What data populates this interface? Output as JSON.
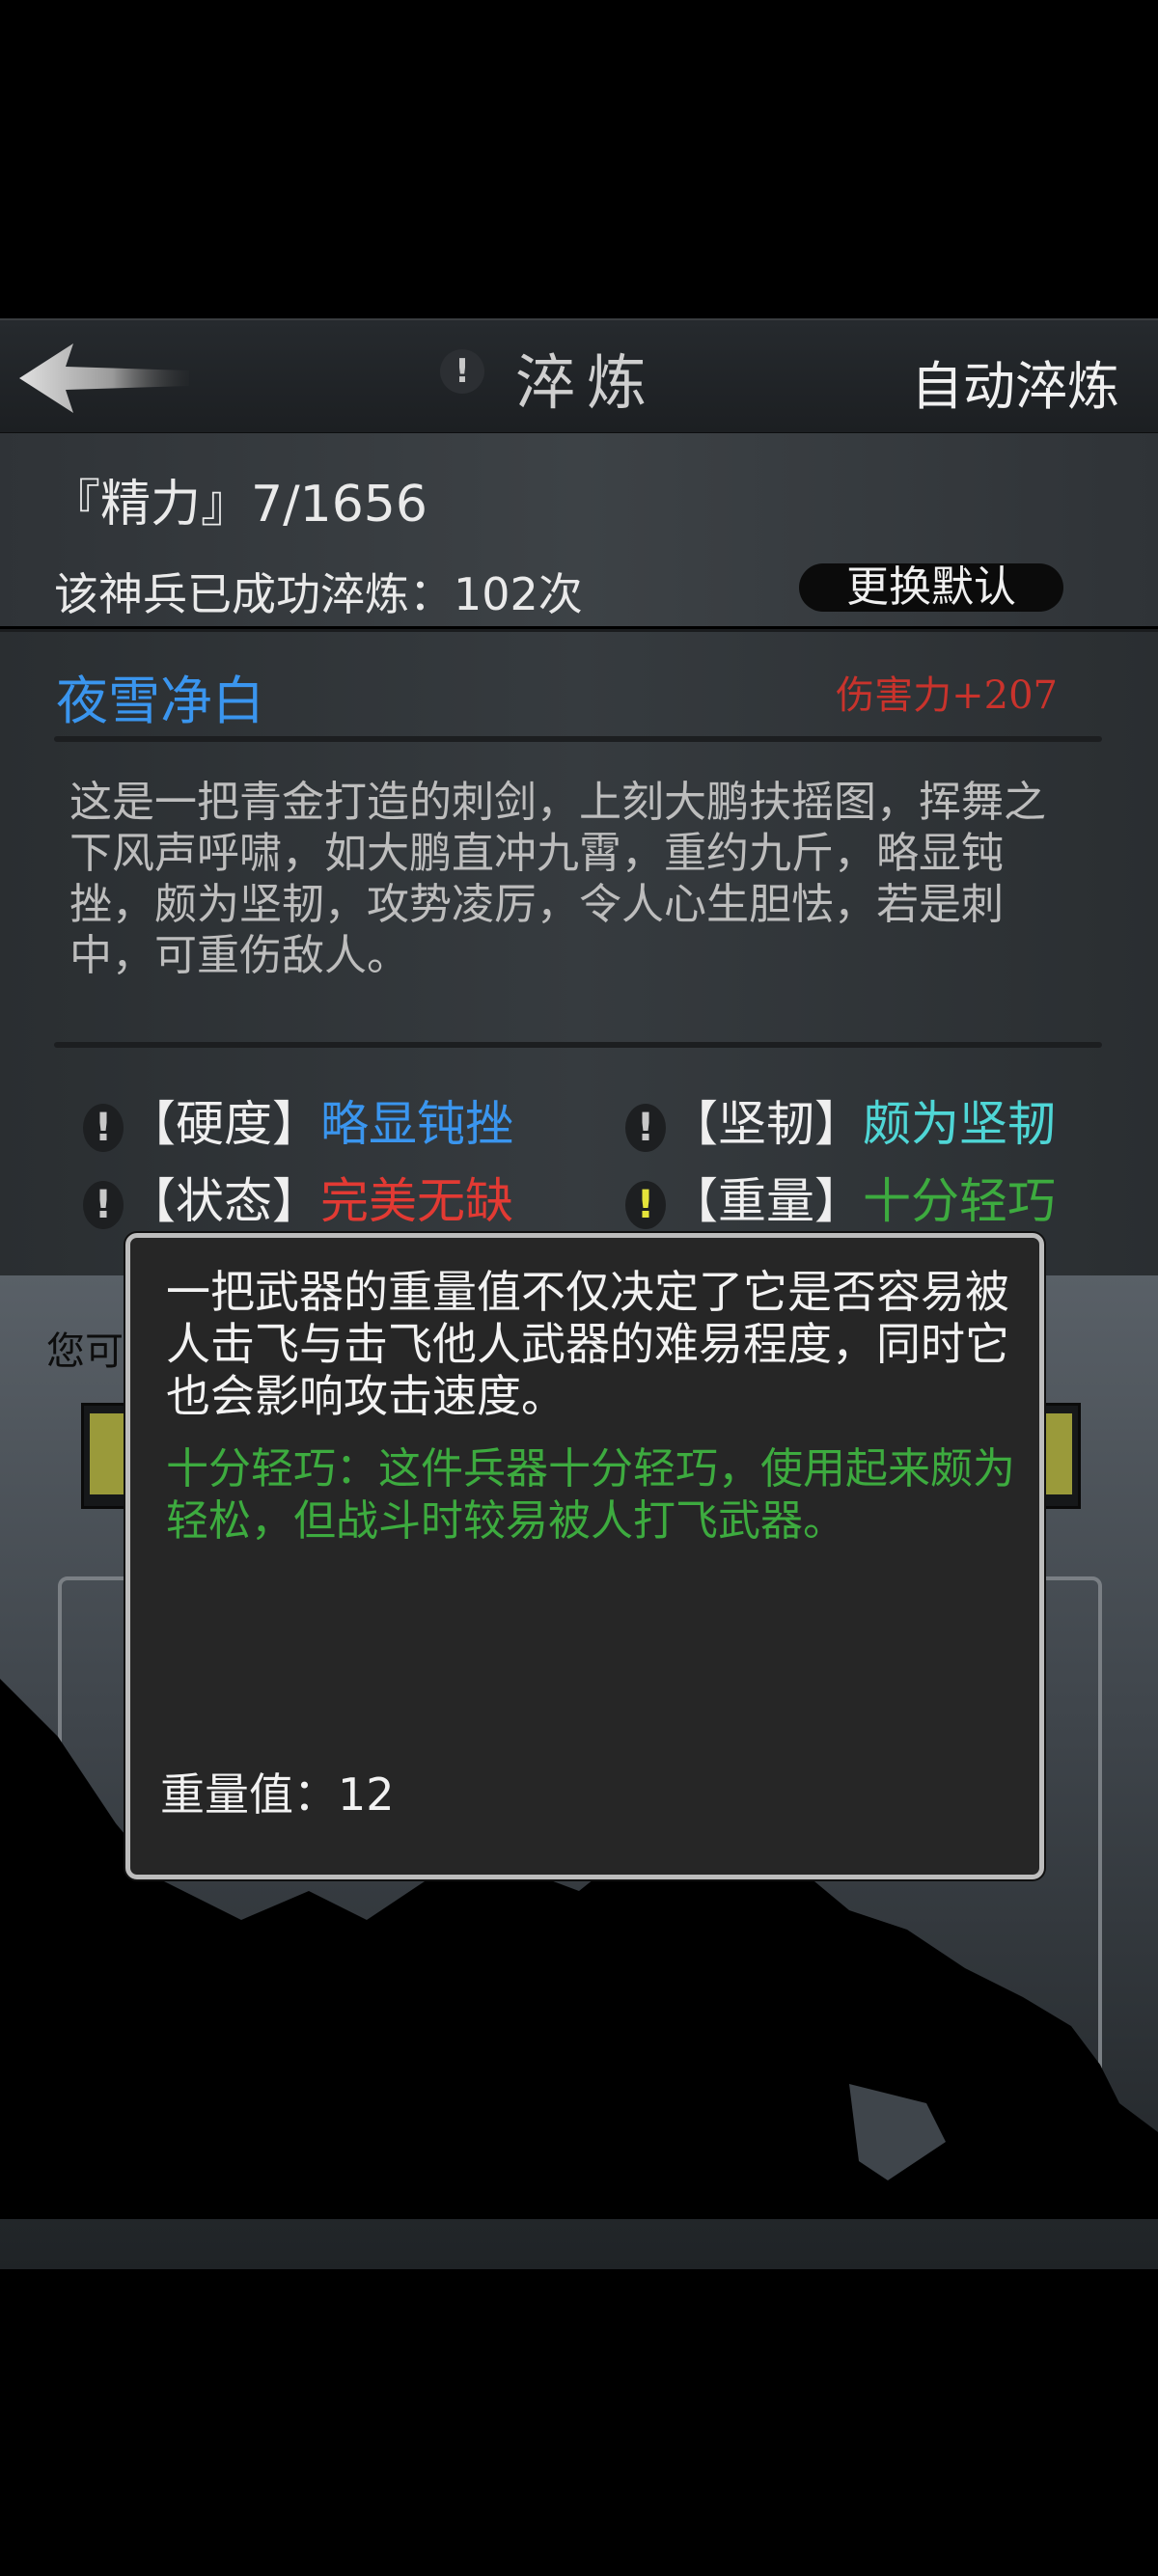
{
  "header": {
    "title": "淬炼",
    "info_icon": "!",
    "auto_label": "自动淬炼"
  },
  "status": {
    "energy": "『精力』7/1656",
    "refine_count": "该神兵已成功淬炼：102次",
    "change_default": "更换默认"
  },
  "weapon": {
    "name": "夜雪净白",
    "damage": "伤害力+207",
    "description": "这是一把青金打造的刺剑，上刻大鹏扶摇图，挥舞之下风声呼啸，如大鹏直冲九霄，重约九斤，略显钝挫，颇为坚韧，攻势凌厉，令人心生胆怯，若是刺中，可重伤敌人。"
  },
  "attributes": [
    {
      "icon": "!",
      "label": "【硬度】",
      "value": "略显钝挫",
      "color": "#3a95ee"
    },
    {
      "icon": "!",
      "label": "【坚韧】",
      "value": "颇为坚韧",
      "color": "#4fd6d6"
    },
    {
      "icon": "!",
      "label": "【状态】",
      "value": "完美无缺",
      "color": "#e23a33"
    },
    {
      "icon": "!",
      "label": "【重量】",
      "value": "十分轻巧",
      "color": "#3dab3f"
    }
  ],
  "background": {
    "hint_partial": "您可"
  },
  "tooltip": {
    "main": "一把武器的重量值不仅决定了它是否容易被人击飞与击飞他人武器的难易程度，同时它也会影响攻击速度。",
    "detail": "十分轻巧：这件兵器十分轻巧，使用起来颇为轻松，但战斗时较易被人打飞武器。",
    "value_line": "重量值：12"
  }
}
